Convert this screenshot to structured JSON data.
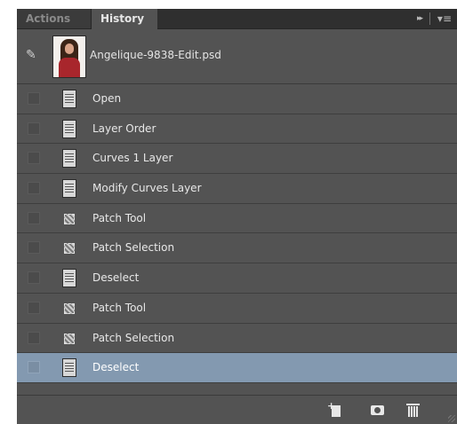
{
  "tabs": [
    {
      "label": "Actions"
    },
    {
      "label": "History"
    }
  ],
  "panel_controls": {
    "collapse": "▸▸",
    "menu": "▾≡"
  },
  "snapshot": {
    "name": "Angelique-9838-Edit.psd",
    "icon": "history-brush-icon"
  },
  "history": [
    {
      "label": "Open",
      "icon": "document-icon"
    },
    {
      "label": "Layer Order",
      "icon": "document-icon"
    },
    {
      "label": "Curves 1 Layer",
      "icon": "document-icon"
    },
    {
      "label": "Modify Curves Layer",
      "icon": "document-icon"
    },
    {
      "label": "Patch Tool",
      "icon": "patch-tool-icon"
    },
    {
      "label": "Patch Selection",
      "icon": "patch-tool-icon"
    },
    {
      "label": "Deselect",
      "icon": "document-icon"
    },
    {
      "label": "Patch Tool",
      "icon": "patch-tool-icon"
    },
    {
      "label": "Patch Selection",
      "icon": "patch-tool-icon"
    },
    {
      "label": "Deselect",
      "icon": "document-icon",
      "selected": true
    }
  ],
  "footer": {
    "buttons": [
      "new-document-from-state-icon",
      "camera-icon",
      "trash-icon"
    ]
  },
  "colors": {
    "panel_bg": "#535353",
    "selected_row": "#8399b0",
    "tab_bar": "#2f2f2f"
  }
}
